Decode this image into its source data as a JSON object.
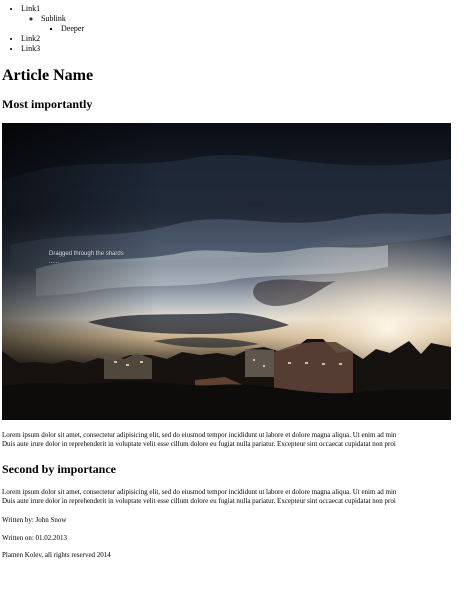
{
  "nav": {
    "link1": "Link1",
    "sublink": "Sublink",
    "deeper": "Deeper",
    "link2": "Link2",
    "link3": "Link3"
  },
  "article": {
    "title": "Article Name",
    "section1_heading": "Most importantly",
    "image": {
      "caption": "Dragged through the shards",
      "caption_sub": "......"
    },
    "section1_lines": [
      "Lorem ipsum dolor sit amet, consectetur adipisicing elit, sed do eiusmod tempor incididunt ut labore et dolore magna aliqua. Ut enim ad min",
      "Duis aute irure dolor in reprehenderit in voluptate velit esse cillum dolore eu fugiat nulla pariatur. Excepteur sint occaecat cupidatat non proi"
    ],
    "section2_heading": "Second by importance",
    "section2_lines": [
      "Lorem ipsum dolor sit amet, consectetur adipisicing elit, sed do eiusmod tempor incididunt ut labore et dolore magna aliqua. Ut enim ad min",
      "Duis aute irure dolor in reprehenderit in voluptate velit esse cillum dolore eu fugiat nulla pariatur. Excepteur sint occaecat cupidatat non proi"
    ],
    "author": "Written by: John Snow",
    "date": "Written on: 01.02.2013"
  },
  "footer": {
    "copyright": "Plamen Kolev, all rights reserved 2014"
  }
}
